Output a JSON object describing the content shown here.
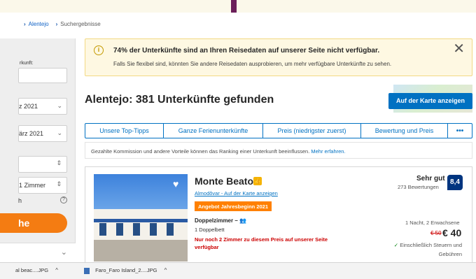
{
  "breadcrumb": {
    "sep": "›",
    "region": "Alentejo",
    "current": "Suchergebnisse"
  },
  "sidebar": {
    "label_origin": "rkunft:",
    "checkin": "z 2021",
    "checkout": "ärz 2021",
    "rooms": "1 Zimmer",
    "letter": "h",
    "search_label": "he",
    "info": "?",
    "chevron": "⌄",
    "updown": "⇕"
  },
  "alert": {
    "icon": "i",
    "title": "74% der Unterkünfte sind an Ihren Reisedaten auf unserer Seite nicht verfügbar.",
    "text": "Falls Sie flexibel sind, könnten Sie andere Reisedaten ausprobieren, um mehr verfügbare Unterkünfte zu sehen.",
    "close": "✕"
  },
  "map_button": "Auf der Karte anzeigen",
  "heading": "Alentejo: 381 Unterkünfte gefunden",
  "sort_tabs": [
    "Unsere Top-Tipps",
    "Ganze Ferienunterkünfte",
    "Preis (niedrigster zuerst)",
    "Bewertung und Preis",
    "•••"
  ],
  "notice": {
    "text": "Gezahlte Kommission und andere Vorteile können das Ranking einer Unterkunft beeinflussen.",
    "link": "Mehr erfahren."
  },
  "property": {
    "name": "Monte Beato",
    "badge": "👍",
    "location": "Almodôvar - Auf der Karte anzeigen",
    "deal": "Angebot Jahresbeginn 2021",
    "room_type": "Doppelzimmer",
    "room_suffix": "– 👥",
    "bed": "1 Doppelbett",
    "scarcity": "Nur noch 2 Zimmer zu diesem Preis auf unserer Seite verfügbar",
    "score_word": "Sehr gut",
    "score_count": "273 Bewertungen",
    "score": "8,4",
    "guests": "1 Nacht, 2 Erwachsene",
    "old_price": "€ 50",
    "new_price": "€ 40",
    "tax_check": "✓",
    "tax": "Einschließlich Steuern und Gebühren",
    "heart": "♥"
  },
  "downloads": [
    {
      "name": "al beac....JPG",
      "caret": "^"
    },
    {
      "name": "Faro_Faro Island_2....JPG",
      "caret": "^"
    }
  ]
}
